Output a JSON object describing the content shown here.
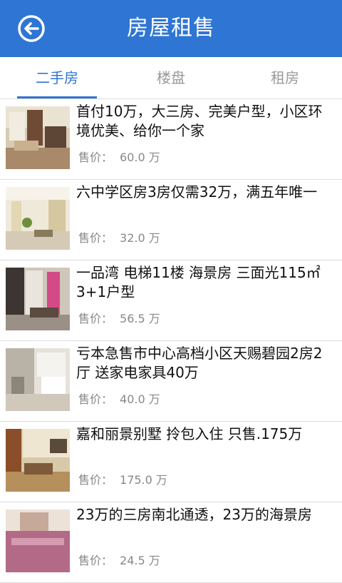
{
  "header": {
    "title": "房屋租售",
    "back_icon": "back-arrow-circle-icon"
  },
  "tabs": [
    {
      "label": "二手房",
      "active": true
    },
    {
      "label": "楼盘",
      "active": false
    },
    {
      "label": "租房",
      "active": false
    }
  ],
  "price_label": "售价：",
  "listings": [
    {
      "title": "首付10万，大三房、完美户型，小区环境优美、给你一个家",
      "price": "60.0 万"
    },
    {
      "title": "六中学区房3房仅需32万，满五年唯一",
      "price": "32.0 万"
    },
    {
      "title": "一品湾 电梯11楼 海景房 三面光115㎡ 3+1户型",
      "price": "56.5 万"
    },
    {
      "title": "亏本急售市中心高档小区天赐碧园2房2厅 送家电家具40万",
      "price": "40.0 万"
    },
    {
      "title": "嘉和丽景别墅 拎包入住 只售.175万",
      "price": "175.0 万"
    },
    {
      "title": "23万的三房南北通透，23万的海景房",
      "price": "24.5 万"
    }
  ],
  "colors": {
    "accent": "#2f75d3",
    "text": "#111111",
    "muted": "#888888",
    "divider": "#dcdcdc"
  }
}
